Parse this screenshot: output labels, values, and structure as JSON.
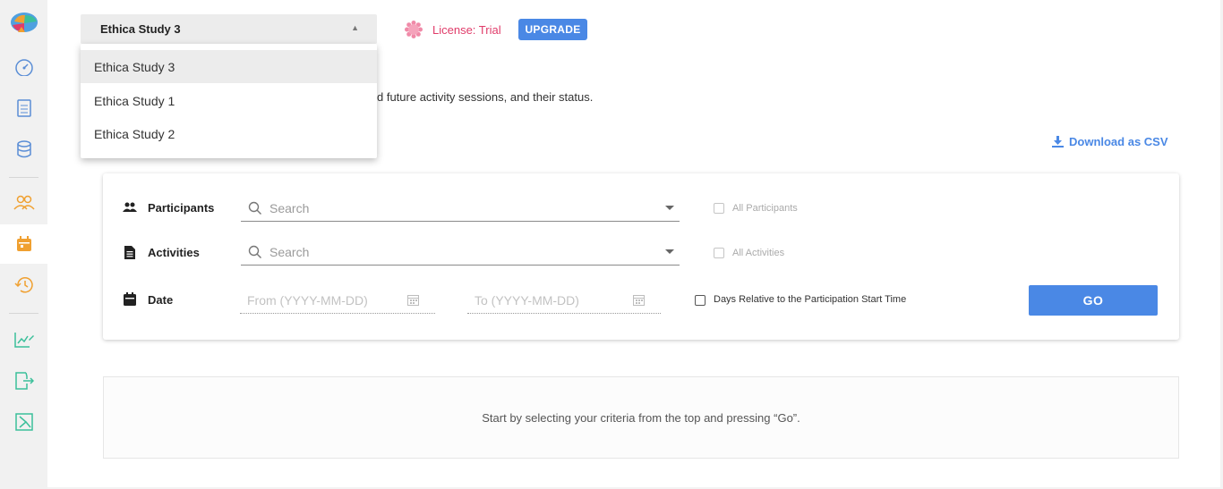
{
  "study_selector": {
    "selected": "Ethica Study 3",
    "options": [
      "Ethica Study 3",
      "Ethica Study 1",
      "Ethica Study 2"
    ]
  },
  "license": {
    "label": "License: Trial",
    "upgrade_label": "UPGRADE"
  },
  "description": "d future activity sessions, and their status.",
  "download_label": "Download as CSV",
  "filters": {
    "participants": {
      "label": "Participants",
      "placeholder": "Search",
      "all_label": "All Participants"
    },
    "activities": {
      "label": "Activities",
      "placeholder": "Search",
      "all_label": "All Activities"
    },
    "date": {
      "label": "Date",
      "from_placeholder": "From  (YYYY-MM-DD)",
      "to_placeholder": "To  (YYYY-MM-DD)",
      "relative_label": "Days Relative to the Participation Start Time"
    },
    "go_label": "GO"
  },
  "empty_message": "Start by selecting your criteria from the top and pressing “Go”.",
  "colors": {
    "accent": "#4a88e5",
    "license": "#e03c6a",
    "sidebar_orange": "#f0a030",
    "sidebar_blue": "#5b8ed6",
    "sidebar_teal": "#3bbf9a"
  },
  "sidebar_icons": [
    "logo-icon",
    "dashboard-icon",
    "document-icon",
    "database-icon",
    "participants-icon",
    "calendar-icon",
    "history-icon",
    "edit-chart-icon",
    "export-icon",
    "formula-icon"
  ]
}
